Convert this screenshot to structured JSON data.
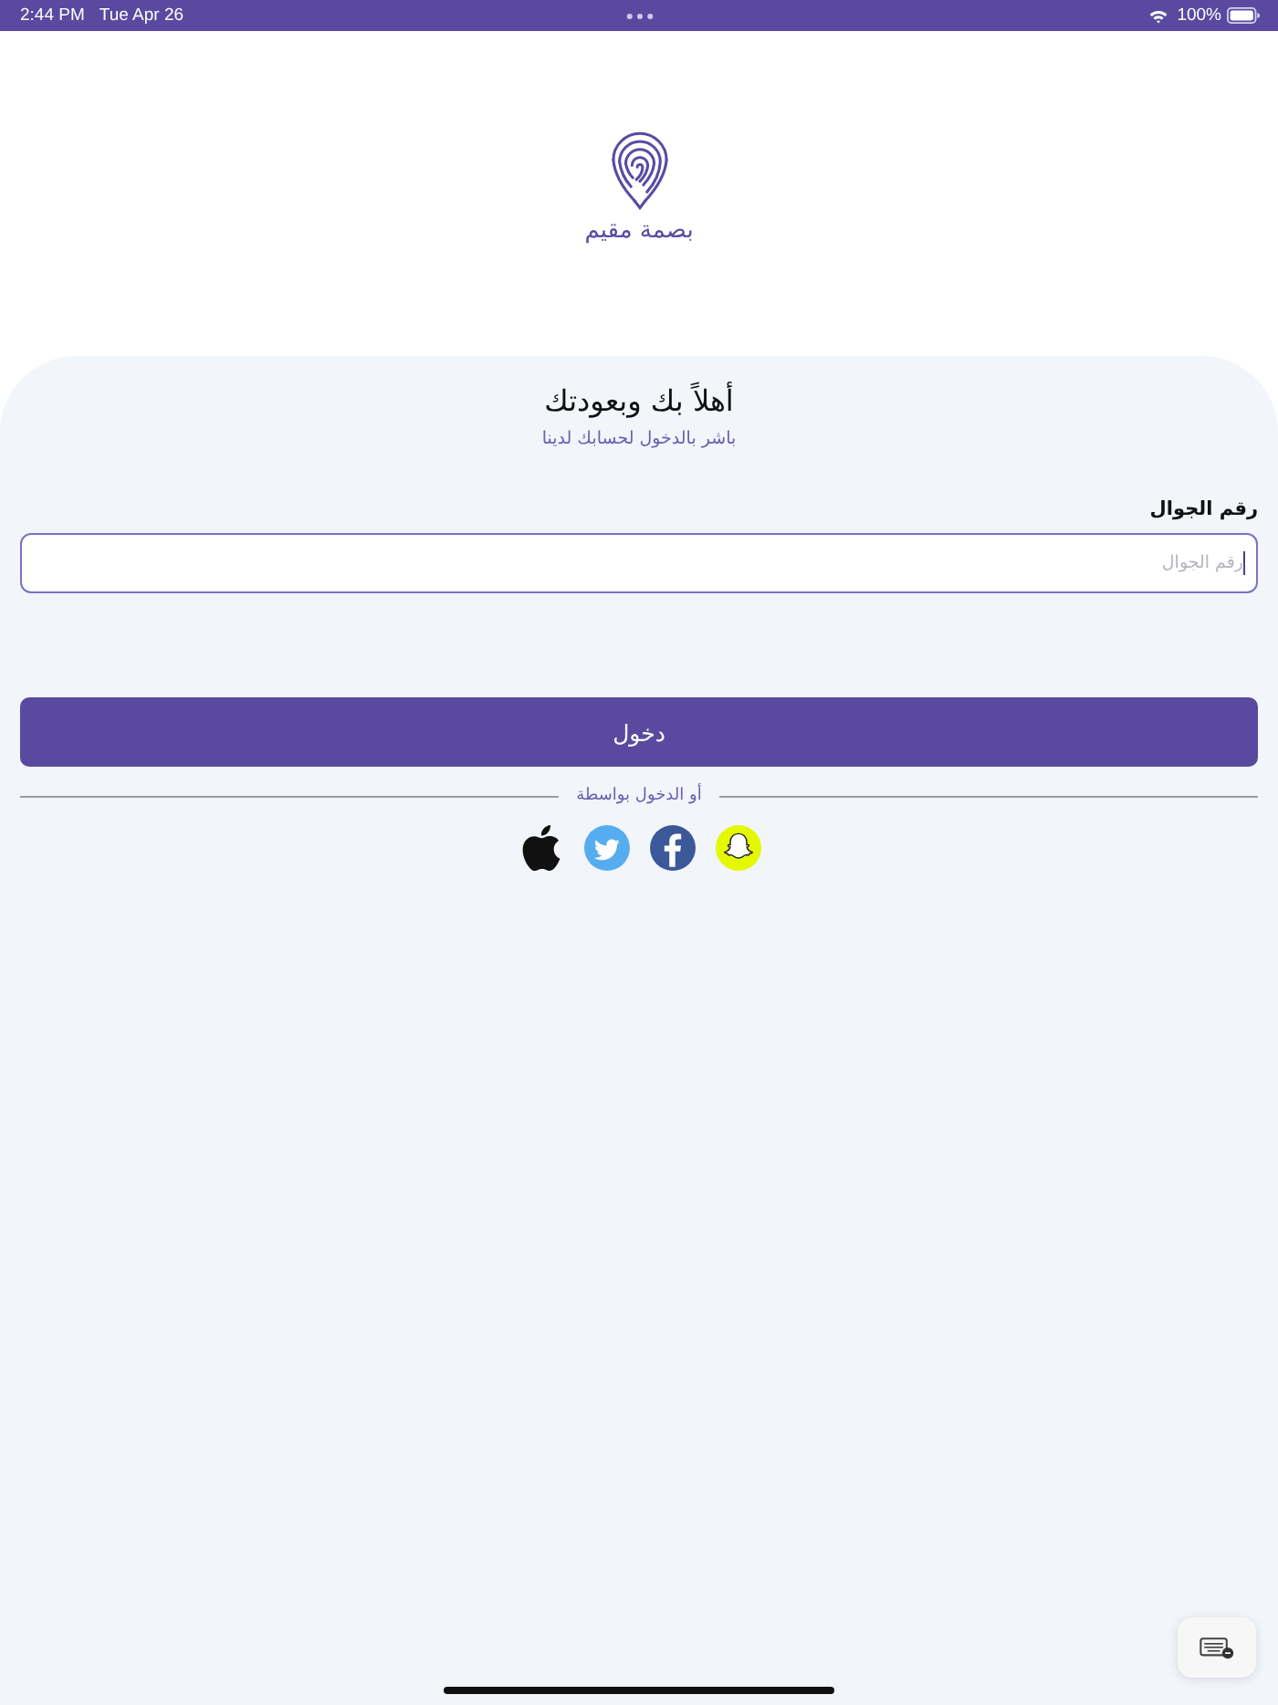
{
  "status_bar": {
    "time": "2:44 PM",
    "date": "Tue Apr 26",
    "battery": "100%"
  },
  "logo": {
    "name": "بصمة مقيم"
  },
  "welcome": {
    "title": "أهلاً بك وبعودتك",
    "subtitle": "باشر بالدخول لحسابك لدينا"
  },
  "phone_field": {
    "label": "رقم الجوال",
    "placeholder": "رقم الجوال",
    "focused": true
  },
  "login_button": {
    "label": "دخول"
  },
  "social_login": {
    "divider_text": "أو الدخول بواسطة"
  }
}
